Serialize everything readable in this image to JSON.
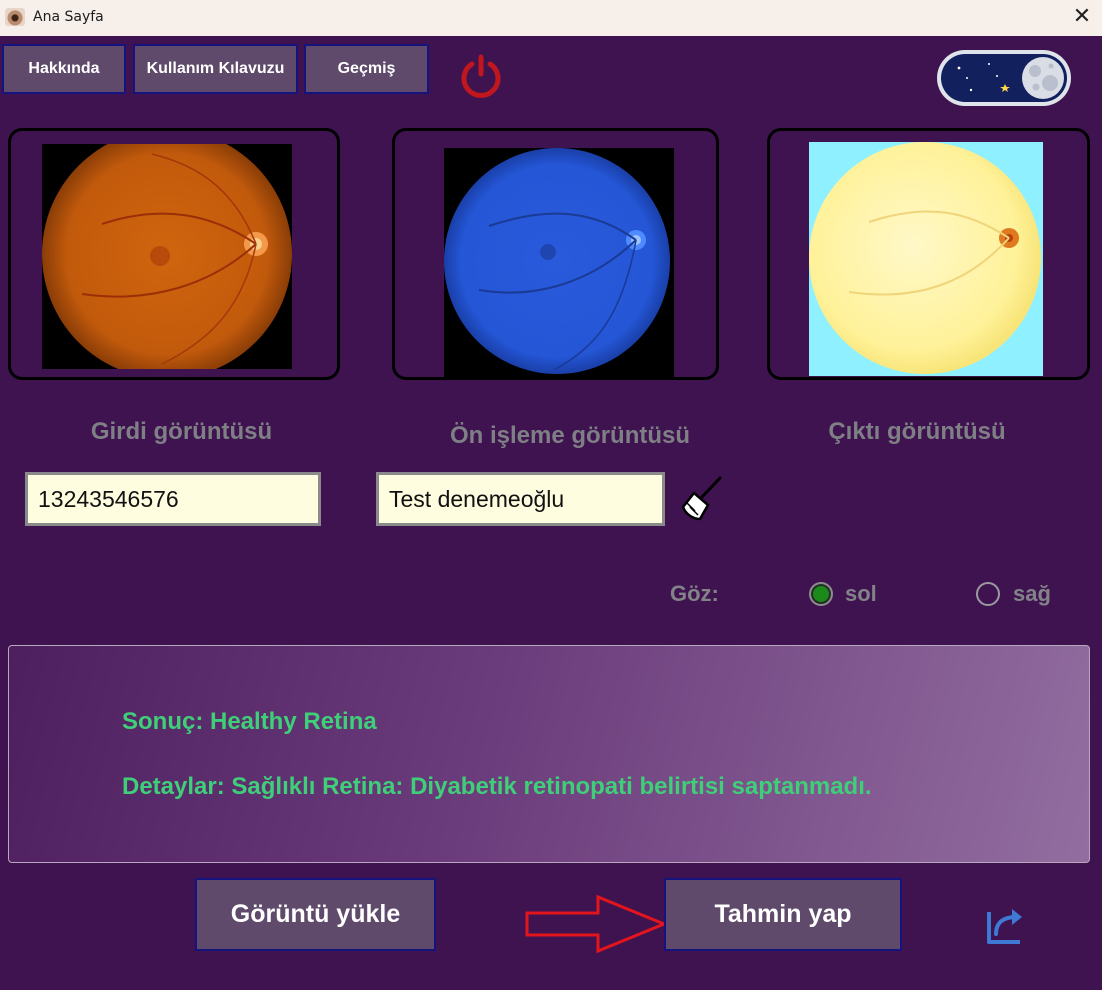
{
  "window": {
    "title": "Ana Sayfa",
    "close_glyph": "✕"
  },
  "toolbar": {
    "about_label": "Hakkında",
    "guide_label": "Kullanım Kılavuzu",
    "history_label": "Geçmiş",
    "power_icon": "power-icon",
    "theme_toggle": "night-mode"
  },
  "panels": {
    "input_caption": "Girdi görüntüsü",
    "preprocess_caption": "Ön işleme görüntüsü",
    "output_caption": "Çıktı görüntüsü"
  },
  "form": {
    "id_value": "13243546576",
    "name_value": "Test denemeoğlu",
    "clear_icon": "broom-icon"
  },
  "eye": {
    "label": "Göz:",
    "options": [
      "sol",
      "sağ"
    ],
    "selected": "sol"
  },
  "result": {
    "summary": "Sonuç: Healthy Retina",
    "details": "Detaylar: Sağlıklı Retina: Diyabetik retinopati belirtisi saptanmadı."
  },
  "actions": {
    "upload_label": "Görüntü yükle",
    "predict_label": "Tahmin yap",
    "export_icon": "share-icon"
  },
  "colors": {
    "background": "#3f1350",
    "button": "#5f4a6b",
    "result_text": "#3fcf78",
    "power": "#c0161e",
    "radio_selected": "#1a8a1a"
  }
}
